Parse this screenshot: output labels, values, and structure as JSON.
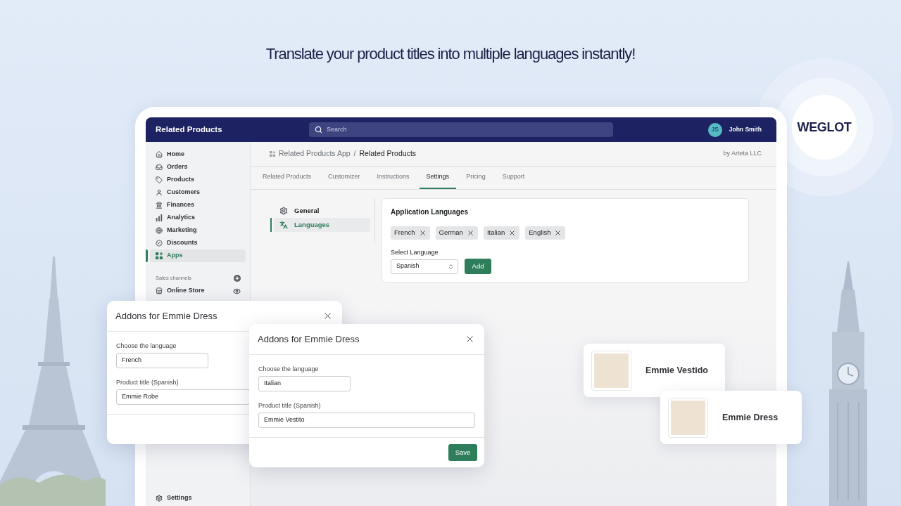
{
  "headline": "Translate your product titles into multiple languages instantly!",
  "logo": {
    "text": "WEGLOT"
  },
  "app": {
    "top_bar": {
      "title": "Related Products",
      "search": {
        "placeholder": "Search"
      },
      "user": {
        "initials": "JS",
        "name": "John Smith"
      }
    },
    "sidebar": {
      "items": [
        {
          "label": "Home",
          "selected": false
        },
        {
          "label": "Orders",
          "selected": false
        },
        {
          "label": "Products",
          "selected": false
        },
        {
          "label": "Customers",
          "selected": false
        },
        {
          "label": "Finances",
          "selected": false
        },
        {
          "label": "Analytics",
          "selected": false
        },
        {
          "label": "Marketing",
          "selected": false
        },
        {
          "label": "Discounts",
          "selected": false
        },
        {
          "label": "Apps",
          "selected": true
        }
      ],
      "sales_channels": {
        "heading": "Sales channels",
        "items": [
          {
            "label": "Online Store"
          }
        ]
      },
      "bottom_item": {
        "label": "Settings"
      }
    },
    "breadcrumb": {
      "parent": "Related Products App",
      "separator": "/",
      "current": "Related Products",
      "vendor": "by Arteta LLC"
    },
    "tabs": [
      {
        "label": "Related Products",
        "selected": false
      },
      {
        "label": "Customizer",
        "selected": false
      },
      {
        "label": "Instructions",
        "selected": false
      },
      {
        "label": "Settings",
        "selected": true
      },
      {
        "label": "Pricing",
        "selected": false
      },
      {
        "label": "Support",
        "selected": false
      }
    ],
    "settings_nav": [
      {
        "label": "General",
        "selected": false
      },
      {
        "label": "Languages",
        "selected": true
      }
    ],
    "languages_card": {
      "title": "Application Languages",
      "tags": [
        {
          "label": "French"
        },
        {
          "label": "German"
        },
        {
          "label": "Italian"
        },
        {
          "label": "English"
        }
      ],
      "select": {
        "label": "Select Language",
        "value": "Spanish"
      },
      "add_button": "Add"
    }
  },
  "dialogs": [
    {
      "title": "Addons for Emmie Dress",
      "fields": [
        {
          "label": "Choose the language",
          "value": "French"
        },
        {
          "label": "Product title (Spanish)",
          "value": "Emmie Robe"
        }
      ]
    },
    {
      "title": "Addons for Emmie Dress",
      "fields": [
        {
          "label": "Choose the language",
          "value": "Italian"
        },
        {
          "label": "Product title (Spanish)",
          "value": "Emmie Vestito"
        }
      ],
      "save_button": "Save"
    }
  ],
  "product_cards": [
    {
      "name": "Emmie Vestido"
    },
    {
      "name": "Emmie Dress"
    }
  ]
}
